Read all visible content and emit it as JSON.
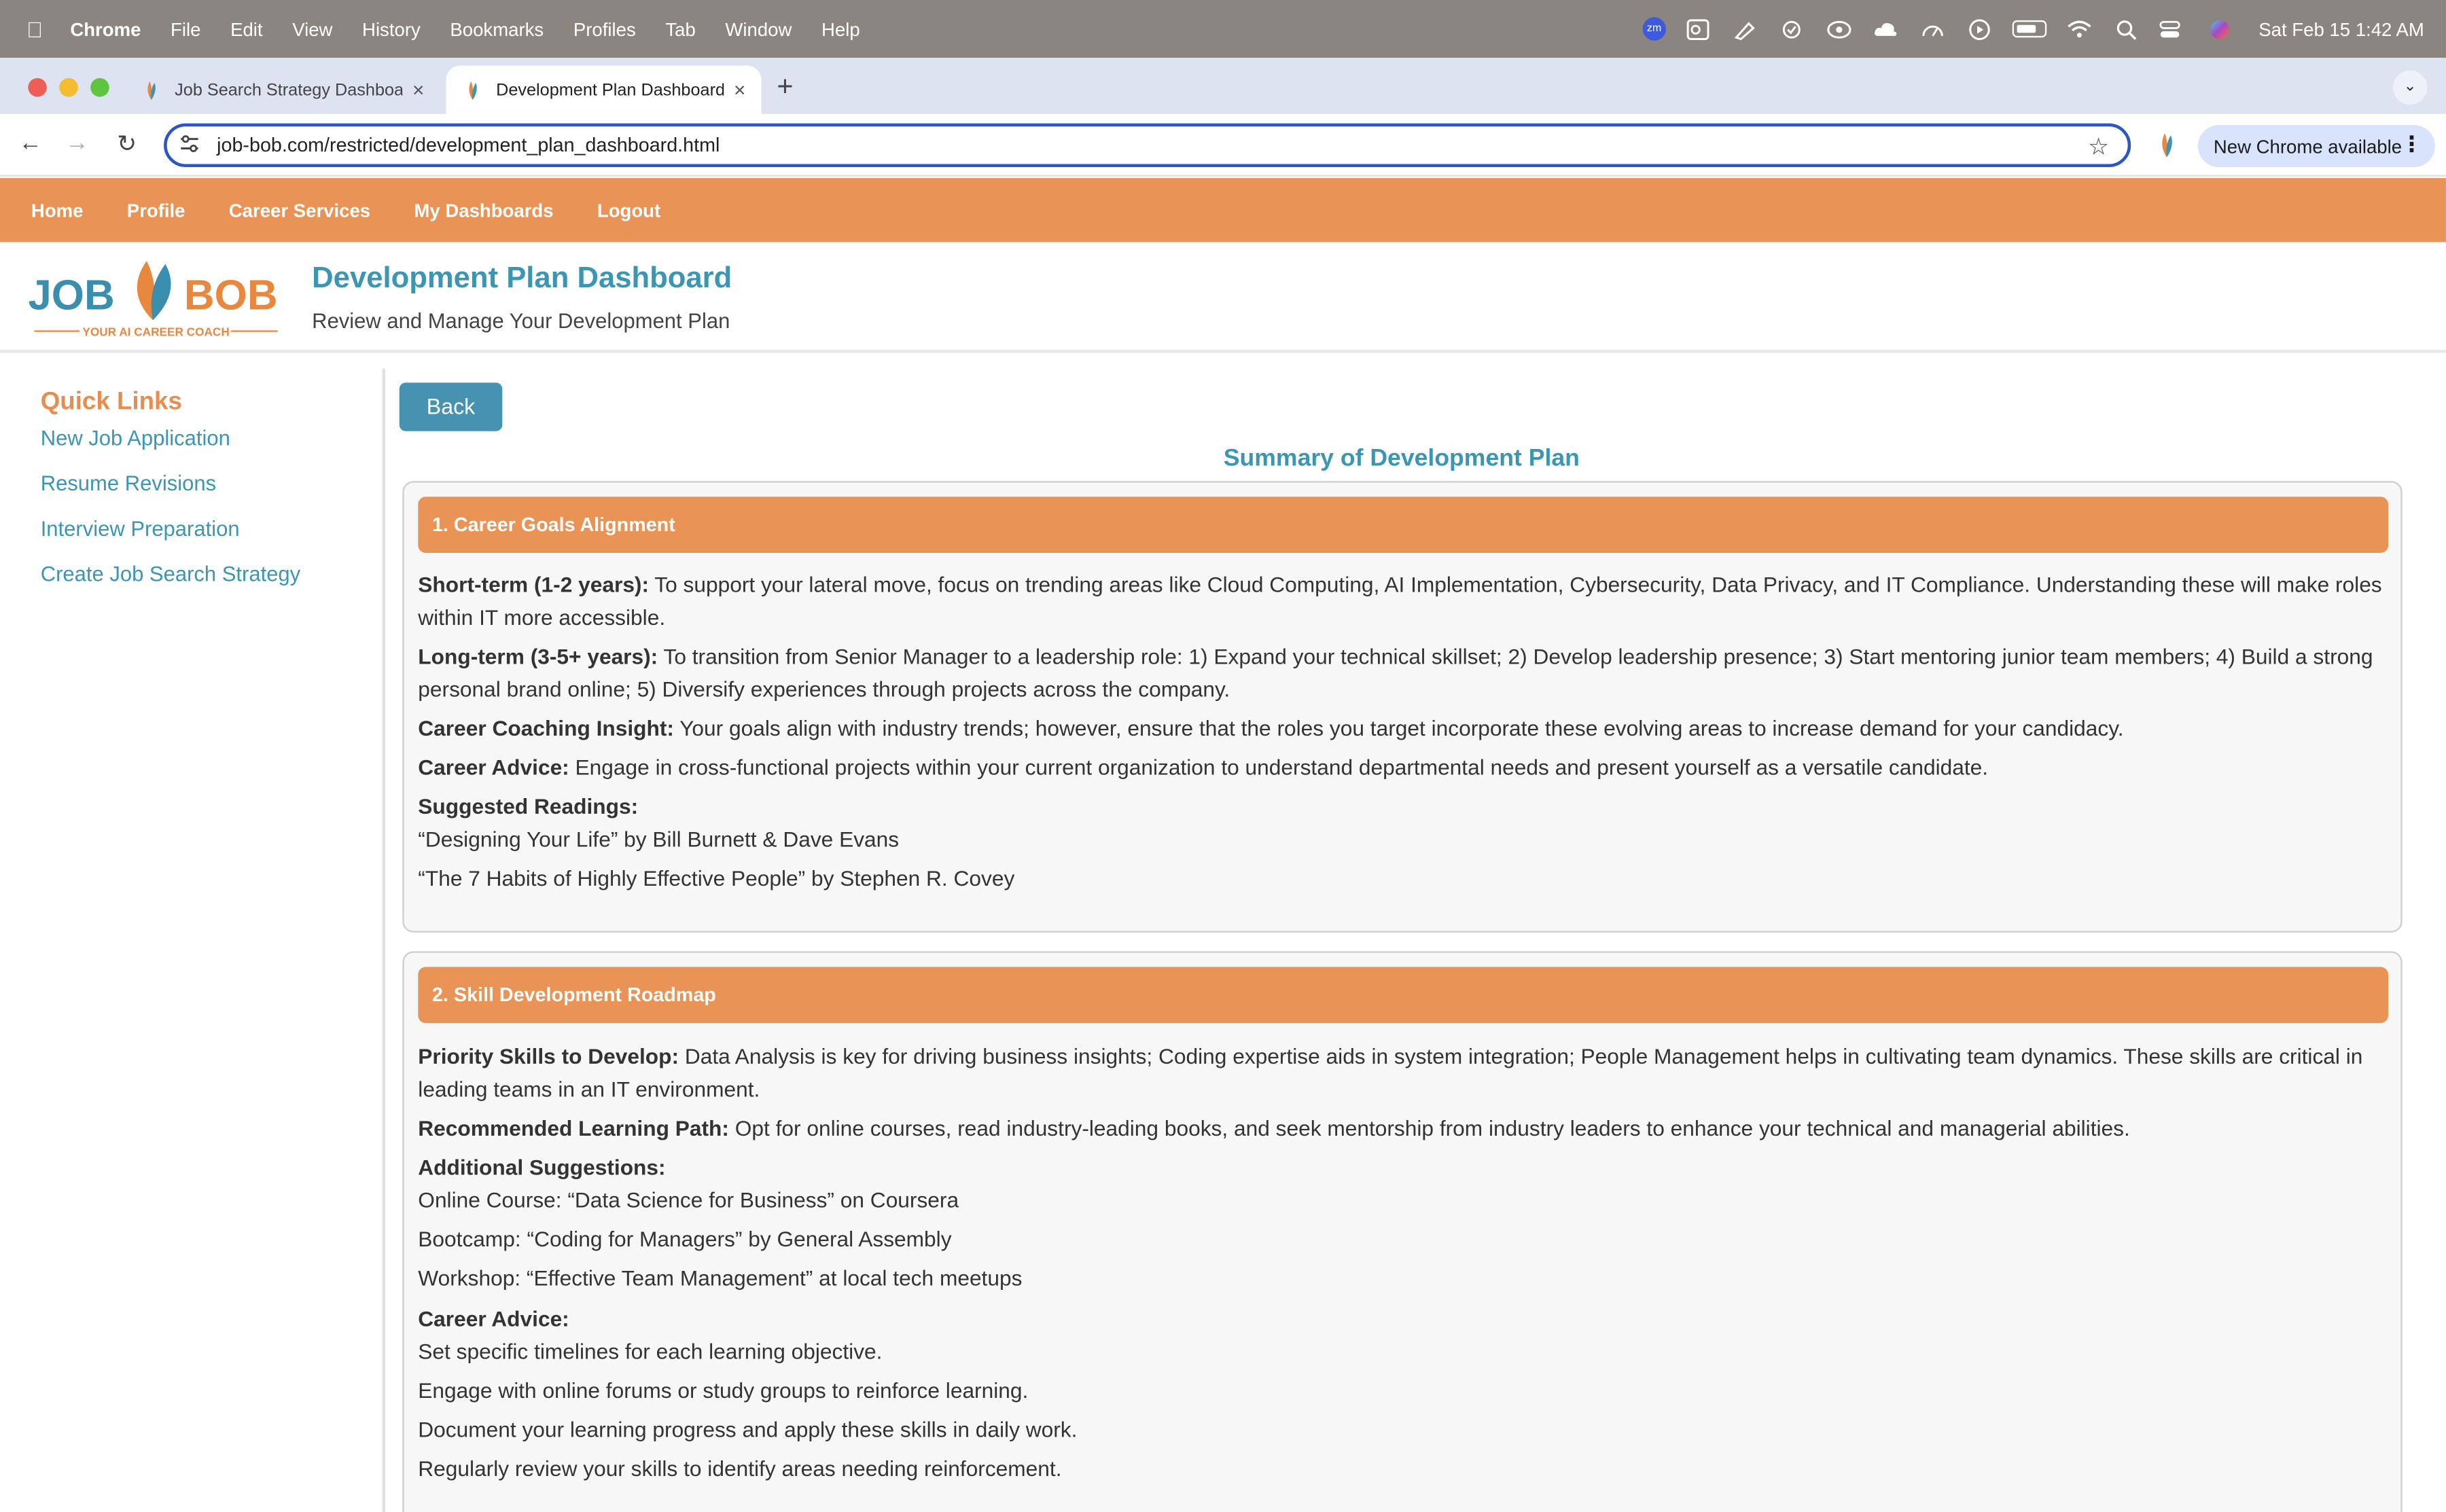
{
  "menubar": {
    "app": "Chrome",
    "items": [
      "File",
      "Edit",
      "View",
      "History",
      "Bookmarks",
      "Profiles",
      "Tab",
      "Window",
      "Help"
    ],
    "clock": "Sat Feb 15  1:42 AM",
    "zoom_badge": "zm"
  },
  "browser": {
    "tabs": [
      {
        "title": "Job Search Strategy Dashboard",
        "active": false
      },
      {
        "title": "Development Plan Dashboard",
        "active": true
      }
    ],
    "url": "job-bob.com/restricted/development_plan_dashboard.html",
    "update_label": "New Chrome available"
  },
  "colors": {
    "accent_orange": "#e99456",
    "teal": "#3a96b3",
    "button_blue": "#4593b0"
  },
  "site_nav": [
    "Home",
    "Profile",
    "Career Services",
    "My Dashboards",
    "Logout"
  ],
  "header": {
    "logo_text_left": "JOB",
    "logo_text_right": "BOB",
    "logo_tagline": "YOUR AI CAREER COACH",
    "title": "Development Plan Dashboard",
    "subtitle": "Review and Manage Your Development Plan"
  },
  "sidebar": {
    "title": "Quick Links",
    "links": [
      "New Job Application",
      "Resume Revisions",
      "Interview Preparation",
      "Create Job Search Strategy"
    ]
  },
  "main": {
    "back_label": "Back",
    "summary_title": "Summary of Development Plan",
    "sections": [
      {
        "heading": "1. Career Goals Alignment",
        "lines": [
          {
            "label": "Short-term (1-2 years):",
            "text": " To support your lateral move, focus on trending areas like Cloud Computing, AI Implementation, Cybersecurity, Data Privacy, and IT Compliance. Understanding these will make roles within IT more accessible."
          },
          {
            "label": "Long-term (3-5+ years):",
            "text": " To transition from Senior Manager to a leadership role: 1) Expand your technical skillset; 2) Develop leadership presence; 3) Start mentoring junior team members; 4) Build a strong personal brand online; 5) Diversify experiences through projects across the company."
          },
          {
            "label": "Career Coaching Insight:",
            "text": " Your goals align with industry trends; however, ensure that the roles you target incorporate these evolving areas to increase demand for your candidacy."
          },
          {
            "label": "Career Advice:",
            "text": " Engage in cross-functional projects within your current organization to understand departmental needs and present yourself as a versatile candidate."
          },
          {
            "label": "Suggested Readings:",
            "text": ""
          },
          {
            "label": "",
            "text": "“Designing Your Life” by Bill Burnett & Dave Evans"
          },
          {
            "label": "",
            "text": "“The 7 Habits of Highly Effective People” by Stephen R. Covey"
          }
        ]
      },
      {
        "heading": "2. Skill Development Roadmap",
        "lines": [
          {
            "label": "Priority Skills to Develop:",
            "text": " Data Analysis is key for driving business insights; Coding expertise aids in system integration; People Management helps in cultivating team dynamics. These skills are critical in leading teams in an IT environment."
          },
          {
            "label": "Recommended Learning Path:",
            "text": " Opt for online courses, read industry-leading books, and seek mentorship from industry leaders to enhance your technical and managerial abilities."
          },
          {
            "label": "Additional Suggestions:",
            "text": ""
          },
          {
            "label": "",
            "text": "Online Course: “Data Science for Business” on Coursera"
          },
          {
            "label": "",
            "text": "Bootcamp: “Coding for Managers” by General Assembly"
          },
          {
            "label": "",
            "text": "Workshop: “Effective Team Management” at local tech meetups"
          },
          {
            "label": "Career Advice:",
            "text": ""
          },
          {
            "label": "",
            "text": "Set specific timelines for each learning objective."
          },
          {
            "label": "",
            "text": "Engage with online forums or study groups to reinforce learning."
          },
          {
            "label": "",
            "text": "Document your learning progress and apply these skills in daily work."
          },
          {
            "label": "",
            "text": "Regularly review your skills to identify areas needing reinforcement."
          }
        ]
      }
    ]
  }
}
